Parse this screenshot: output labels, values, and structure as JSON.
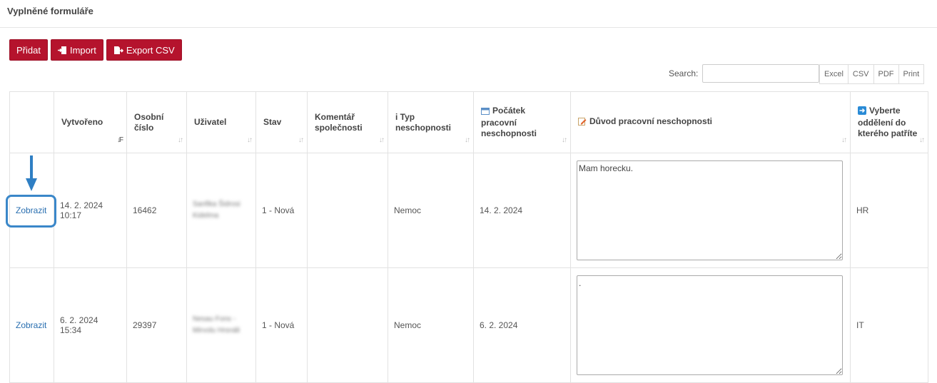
{
  "page": {
    "title": "Vyplněné formuláře"
  },
  "toolbar": {
    "add_label": "Přidat",
    "import_label": "Import",
    "export_csv_label": "Export CSV"
  },
  "search": {
    "label": "Search:",
    "value": ""
  },
  "export_buttons": [
    "Excel",
    "CSV",
    "PDF",
    "Print"
  ],
  "table": {
    "columns": {
      "created": "Vytvořeno",
      "personal_number": "Osobní číslo",
      "user": "Uživatel",
      "status": "Stav",
      "company_comment": "Komentář společnosti",
      "type": "i Typ neschopnosti",
      "start": "Počátek pracovní neschopnosti",
      "reason": "Důvod pracovní neschopnosti",
      "department": "Vyberte oddělení do kterého patříte"
    },
    "rows": [
      {
        "action": "Zobrazit",
        "created": "14. 2. 2024 10:17",
        "personal_number": "16462",
        "user": "Sanfika Šidrosi Kidelma",
        "status": "1 - Nová",
        "company_comment": "",
        "type": "Nemoc",
        "start": "14. 2. 2024",
        "reason": "Mam horecku.",
        "department": "HR"
      },
      {
        "action": "Zobrazit",
        "created": "6. 2. 2024 15:34",
        "personal_number": "29397",
        "user": "Nesau Fons - Mirvolu Hrsnáli",
        "status": "1 - Nová",
        "company_comment": "",
        "type": "Nemoc",
        "start": "6. 2. 2024",
        "reason": ".",
        "department": "IT"
      }
    ]
  },
  "colors": {
    "primary": "#b5132d",
    "link": "#2a6fb0",
    "highlight": "#3a87c9"
  }
}
